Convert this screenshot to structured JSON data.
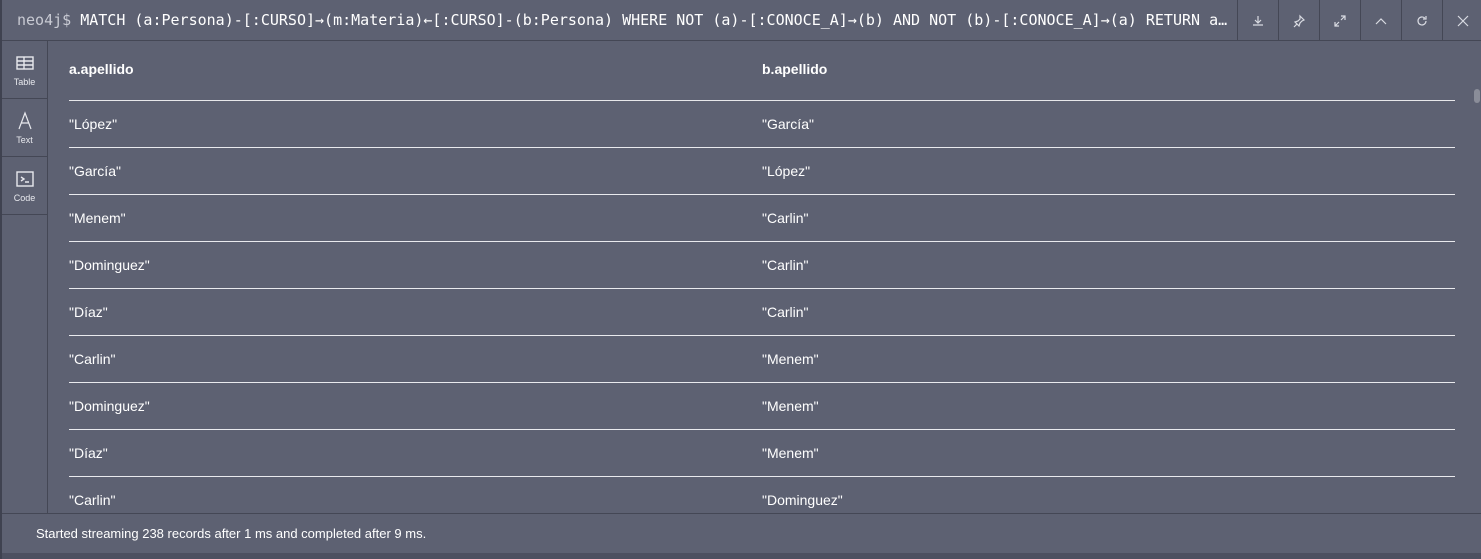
{
  "header": {
    "prompt": "neo4j$",
    "query": "MATCH (a:Persona)-[:CURSO]→(m:Materia)←[:CURSO]-(b:Persona) WHERE NOT (a)-[:CONOCE_A]→(b) AND NOT (b)-[:CONOCE_A]→(a) RETURN a.apellido, b.apellido"
  },
  "actions": [
    {
      "name": "download-icon"
    },
    {
      "name": "pin-icon"
    },
    {
      "name": "expand-icon"
    },
    {
      "name": "collapse-icon"
    },
    {
      "name": "rerun-icon"
    },
    {
      "name": "close-icon"
    }
  ],
  "sidebar": {
    "items": [
      {
        "label": "Table",
        "icon": "table-icon"
      },
      {
        "label": "Text",
        "icon": "text-icon"
      },
      {
        "label": "Code",
        "icon": "code-icon"
      }
    ]
  },
  "table": {
    "columns": [
      "a.apellido",
      "b.apellido"
    ],
    "rows": [
      [
        "\"López\"",
        "\"García\""
      ],
      [
        "\"García\"",
        "\"López\""
      ],
      [
        "\"Menem\"",
        "\"Carlin\""
      ],
      [
        "\"Dominguez\"",
        "\"Carlin\""
      ],
      [
        "\"Díaz\"",
        "\"Carlin\""
      ],
      [
        "\"Carlin\"",
        "\"Menem\""
      ],
      [
        "\"Dominguez\"",
        "\"Menem\""
      ],
      [
        "\"Díaz\"",
        "\"Menem\""
      ],
      [
        "\"Carlin\"",
        "\"Dominguez\""
      ]
    ]
  },
  "footer": {
    "status": "Started streaming 238 records after 1 ms and completed after 9 ms."
  }
}
